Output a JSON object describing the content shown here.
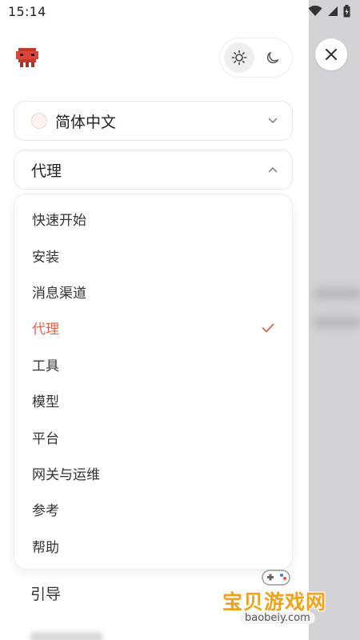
{
  "status_bar": {
    "time": "15:14"
  },
  "header": {
    "theme_light": "sun-icon",
    "theme_dark": "moon-icon",
    "close": "close-icon"
  },
  "language_select": {
    "label": "简体中文"
  },
  "section_select": {
    "label": "代理"
  },
  "dropdown": {
    "items": [
      {
        "label": "快速开始",
        "selected": false
      },
      {
        "label": "安装",
        "selected": false
      },
      {
        "label": "消息渠道",
        "selected": false
      },
      {
        "label": "代理",
        "selected": true
      },
      {
        "label": "工具",
        "selected": false
      },
      {
        "label": "模型",
        "selected": false
      },
      {
        "label": "平台",
        "selected": false
      },
      {
        "label": "网关与运维",
        "selected": false
      },
      {
        "label": "参考",
        "selected": false
      },
      {
        "label": "帮助",
        "selected": false
      }
    ]
  },
  "nav": {
    "guide": "引导"
  },
  "watermark": {
    "text": "宝贝游戏网",
    "url": "baobeiy.com"
  },
  "colors": {
    "accent": "#e0644b",
    "backdrop": "#d3d2d6"
  }
}
